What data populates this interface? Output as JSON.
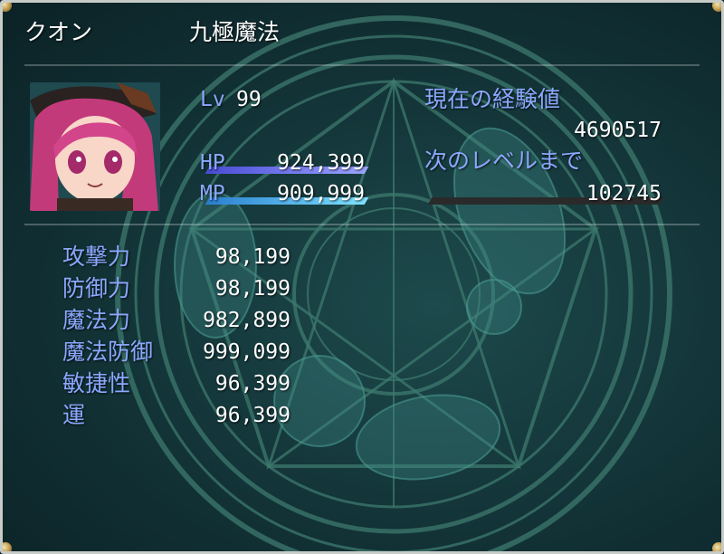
{
  "actor": {
    "name": "クオン",
    "class": "九極魔法",
    "level_label": "Lv",
    "level": "99"
  },
  "exp": {
    "current_label": "現在の経験値",
    "current_value": "4690517",
    "next_label": "次のレベルまで",
    "next_value": "102745",
    "next_gauge_ratio": 0.0
  },
  "gauges": {
    "hp_label": "HP",
    "hp_value": "924,399",
    "hp_ratio": 1.0,
    "hp_colors": [
      "#4a4bd6",
      "#9aa4ff"
    ],
    "mp_label": "MP",
    "mp_value": "909,999",
    "mp_ratio": 1.0,
    "mp_colors": [
      "#2a7fd0",
      "#7fe2ff"
    ]
  },
  "params": [
    {
      "label": "攻撃力",
      "value": "98,199"
    },
    {
      "label": "防御力",
      "value": "98,199"
    },
    {
      "label": "魔法力",
      "value": "982,899"
    },
    {
      "label": "魔法防御",
      "value": "999,099"
    },
    {
      "label": "敏捷性",
      "value": "96,399"
    },
    {
      "label": "運",
      "value": "96,399"
    }
  ],
  "colors": {
    "system_text": "#8ba8ff",
    "window_border": "#c8ccc8",
    "magic_circle": "#3e7a6e"
  },
  "icons": {
    "portrait": "character-portrait-icon",
    "magic_circle": "magic-circle-icon"
  }
}
